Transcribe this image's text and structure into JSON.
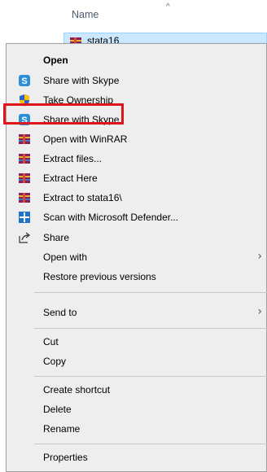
{
  "explorer": {
    "column_header": "Name",
    "selected_file": "stata16"
  },
  "menu": {
    "items": [
      {
        "label": "Open",
        "icon": ""
      },
      {
        "label": "Share with Skype",
        "icon": "skype-icon"
      },
      {
        "label": "Take Ownership",
        "icon": "shield-icon"
      },
      {
        "label": "Share with Skype",
        "icon": "skype-icon"
      },
      {
        "label": "Open with WinRAR",
        "icon": "winrar-icon"
      },
      {
        "label": "Extract files...",
        "icon": "winrar-icon"
      },
      {
        "label": "Extract Here",
        "icon": "winrar-icon"
      },
      {
        "label": "Extract to stata16\\",
        "icon": "winrar-icon"
      },
      {
        "label": "Scan with Microsoft Defender...",
        "icon": "defender-icon"
      },
      {
        "label": "Share",
        "icon": "share-icon"
      },
      {
        "label": "Open with",
        "icon": ""
      },
      {
        "label": "Restore previous versions",
        "icon": ""
      },
      {
        "label": "Send to",
        "icon": ""
      },
      {
        "label": "Cut",
        "icon": ""
      },
      {
        "label": "Copy",
        "icon": ""
      },
      {
        "label": "Create shortcut",
        "icon": ""
      },
      {
        "label": "Delete",
        "icon": ""
      },
      {
        "label": "Rename",
        "icon": ""
      },
      {
        "label": "Properties",
        "icon": ""
      }
    ]
  },
  "colors": {
    "highlight_border": "#e0141c",
    "skype": "#2b8ed9",
    "defender": "#1e74c6"
  }
}
